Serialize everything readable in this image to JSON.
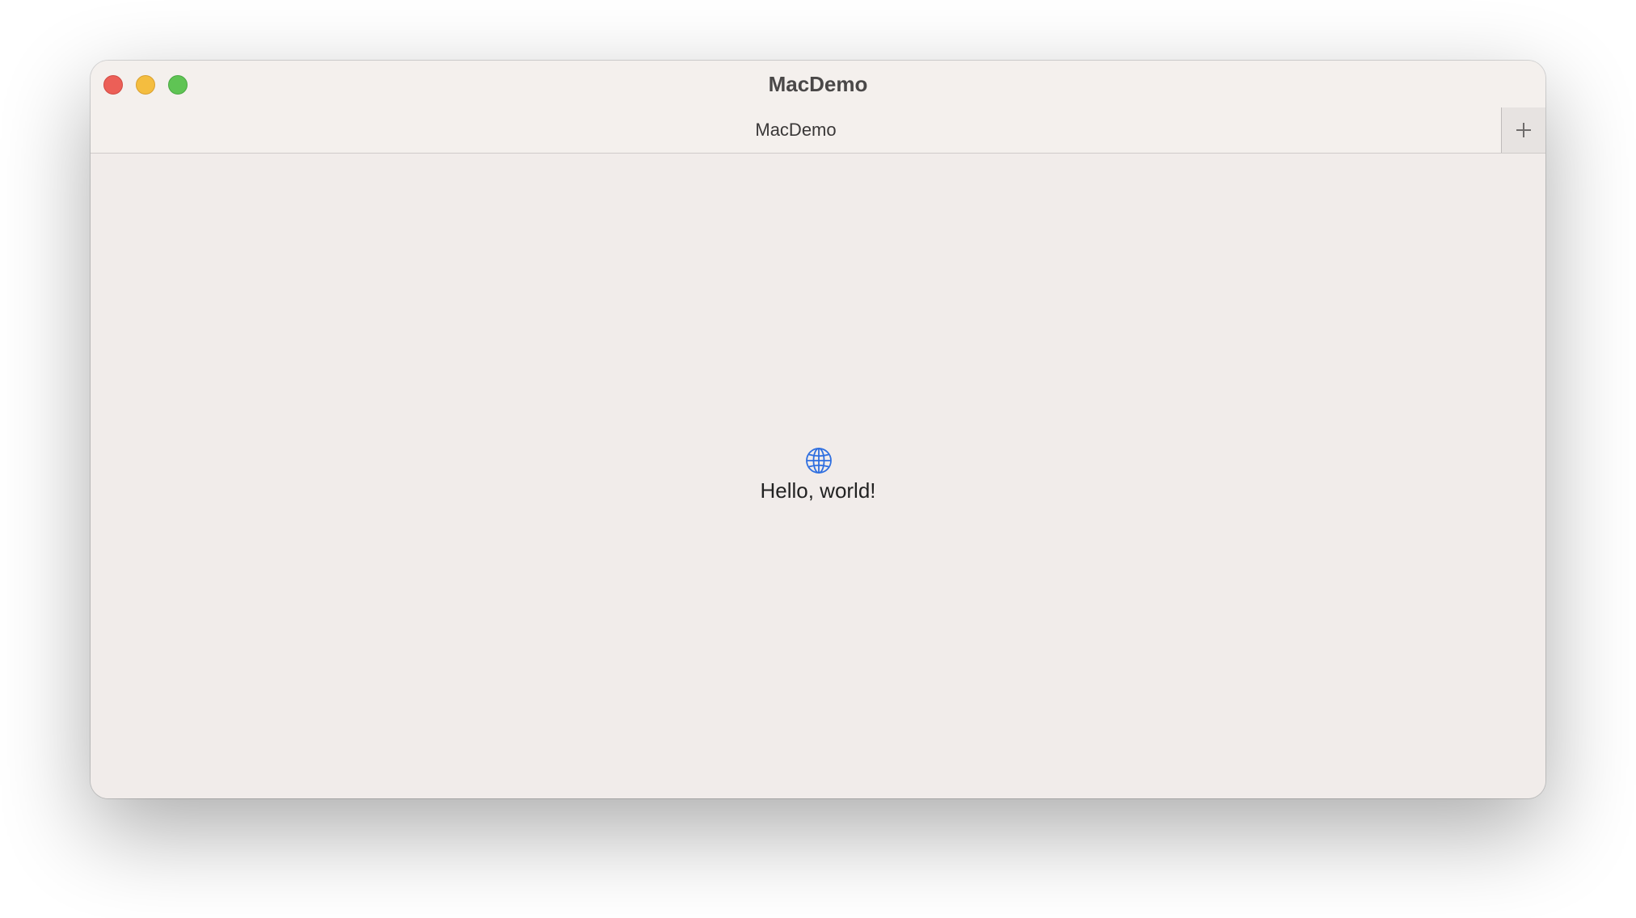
{
  "window": {
    "title": "MacDemo"
  },
  "tabs": [
    {
      "label": "MacDemo"
    }
  ],
  "content": {
    "icon": "globe-icon",
    "message": "Hello, world!"
  },
  "icons": {
    "new_tab": "plus-icon"
  },
  "colors": {
    "close": "#ec5f57",
    "minimize": "#f4bd3f",
    "zoom": "#5fc454",
    "accent": "#2f6fe0"
  }
}
